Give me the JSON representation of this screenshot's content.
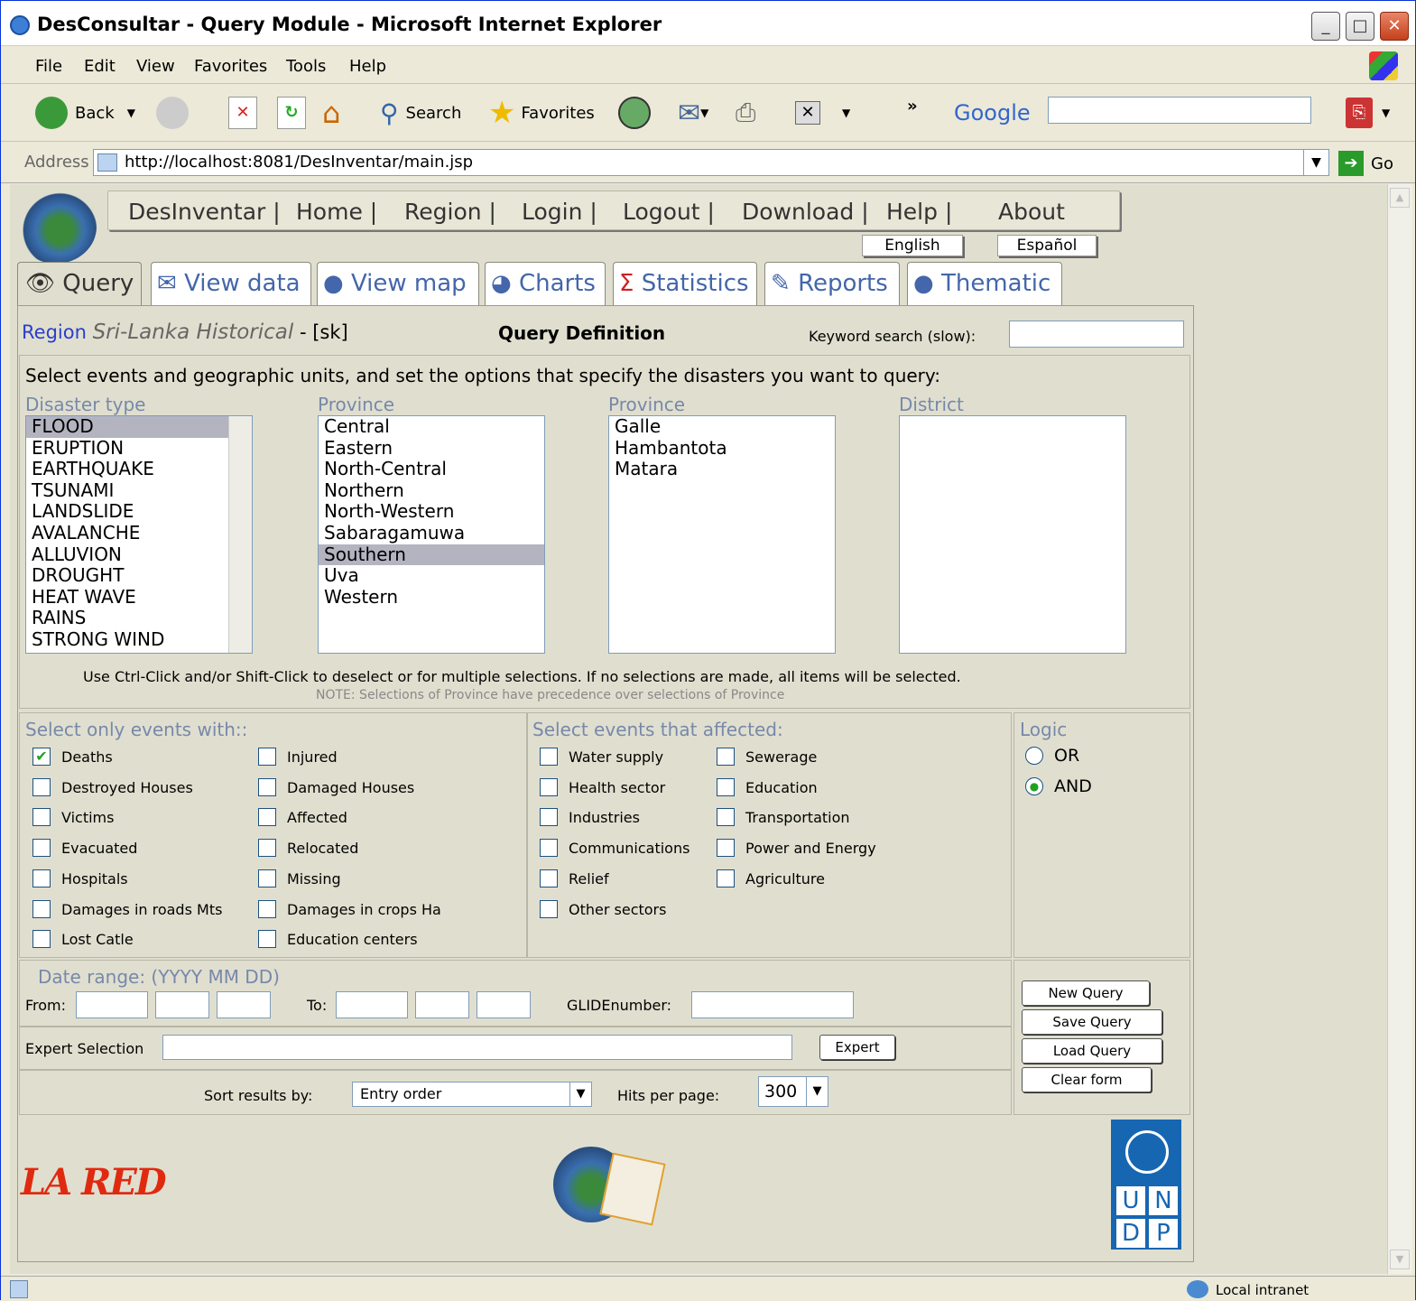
{
  "window": {
    "title": "DesConsultar - Query Module - Microsoft Internet Explorer"
  },
  "menu": [
    "File",
    "Edit",
    "View",
    "Favorites",
    "Tools",
    "Help"
  ],
  "toolbar": {
    "back": "Back",
    "search": "Search",
    "favorites": "Favorites",
    "google": "Google",
    "address_label": "Address",
    "address": "http://localhost:8081/DesInventar/main.jsp",
    "go": "Go"
  },
  "nav": [
    "DesInventar |",
    "Home |",
    "Region |",
    "Login |",
    "Logout |",
    "Download |",
    "Help |",
    "About"
  ],
  "lang": [
    "English",
    "Español"
  ],
  "tabs": [
    "Query",
    "View data",
    "View map",
    "Charts",
    "Statistics",
    "Reports",
    "Thematic"
  ],
  "header": {
    "region_label": "Region",
    "region_name": "Sri-Lanka Historical",
    "region_code": "- [sk]",
    "query_title": "Query Definition",
    "keyword_label": "Keyword search (slow):"
  },
  "instructions": "Select events and geographic units, and set the options that specify the disasters you want to query:",
  "lists": {
    "disaster_label": "Disaster type",
    "disaster": [
      "FLOOD",
      "ERUPTION",
      "EARTHQUAKE",
      "TSUNAMI",
      "LANDSLIDE",
      "AVALANCHE",
      "ALLUVION",
      "DROUGHT",
      "HEAT WAVE",
      "RAINS",
      "STRONG WIND"
    ],
    "province1_label": "Province",
    "province1": [
      "Central",
      "Eastern",
      "North-Central",
      "Northern",
      "North-Western",
      "Sabaragamuwa",
      "Southern",
      "Uva",
      "Western"
    ],
    "province2_label": "Province",
    "province2": [
      "Galle",
      "Hambantota",
      "Matara"
    ],
    "district_label": "District"
  },
  "help": "Use Ctrl-Click and/or Shift-Click to deselect or for multiple selections. If no selections are made, all items will be selected.",
  "note": "NOTE: Selections of Province have precedence over selections of Province",
  "events_with": {
    "label": "Select only events with::",
    "items": [
      "Deaths",
      "Injured",
      "Destroyed Houses",
      "Damaged Houses",
      "Victims",
      "Affected",
      "Evacuated",
      "Relocated",
      "Hospitals",
      "Missing",
      "Damages in roads Mts",
      "Damages in crops Ha",
      "Lost Catle",
      "Education centers"
    ]
  },
  "affected": {
    "label": "Select events that affected:",
    "items": [
      "Water supply",
      "Sewerage",
      "Health sector",
      "Education",
      "Industries",
      "Transportation",
      "Communications",
      "Power and Energy",
      "Relief",
      "Agriculture",
      "Other sectors"
    ]
  },
  "logic": {
    "label": "Logic",
    "or": "OR",
    "and": "AND"
  },
  "date": {
    "label": "Date range: (YYYY MM DD)",
    "from": "From:",
    "to": "To:",
    "glide": "GLIDEnumber:"
  },
  "expert": {
    "label": "Expert Selection",
    "button": "Expert"
  },
  "sort": {
    "label": "Sort results by:",
    "value": "Entry order",
    "hits_label": "Hits per page:",
    "hits": "300"
  },
  "buttons": {
    "new": "New Query",
    "save": "Save Query",
    "load": "Load Query",
    "clear": "Clear form"
  },
  "footer": {
    "lared": "LA RED",
    "undp": [
      "U",
      "N",
      "D",
      "P"
    ]
  },
  "status": {
    "zone": "Local intranet"
  }
}
